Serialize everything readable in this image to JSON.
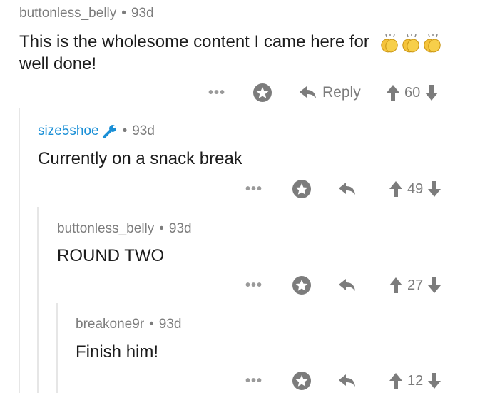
{
  "comments": [
    {
      "username": "buttonless_belly",
      "separator": "•",
      "age": "93d",
      "text_line1": "This is the wholesome content I came here for",
      "text_line2": "well done!",
      "emoji_icons": [
        "clapping-hands-icon",
        "clapping-hands-icon",
        "clapping-hands-icon"
      ],
      "more": "•••",
      "reply_label": "Reply",
      "score": "60"
    },
    {
      "username": "size5shoe",
      "user_badge_icon": "wrench-icon",
      "separator": "•",
      "age": "93d",
      "text": "Currently on a snack break",
      "more": "•••",
      "score": "49"
    },
    {
      "username": "buttonless_belly",
      "separator": "•",
      "age": "93d",
      "text": "ROUND TWO",
      "more": "•••",
      "score": "27"
    },
    {
      "username": "breakone9r",
      "separator": "•",
      "age": "93d",
      "text": "Finish him!",
      "more": "•••",
      "score": "12"
    }
  ],
  "colors": {
    "username_default": "#7c7c7c",
    "username_highlight": "#1a8fd6",
    "clap_fill": "#f5c33b",
    "thread_line": "#e6e6e6"
  }
}
